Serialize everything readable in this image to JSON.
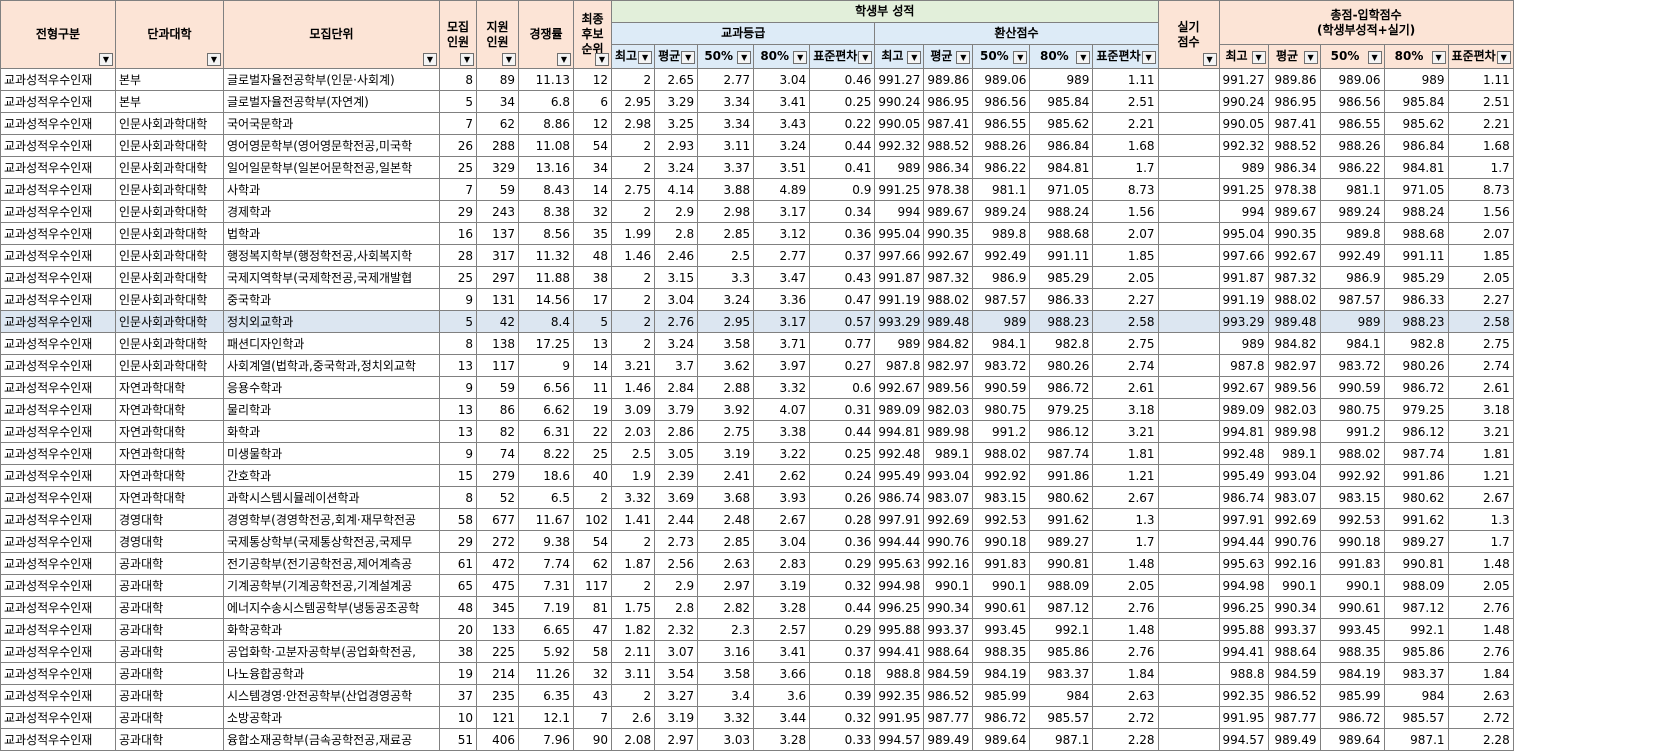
{
  "headers": {
    "type": "전형구분",
    "college": "단과대학",
    "unit": "모집단위",
    "quota": "모집\n인원",
    "applicants": "지원\n인원",
    "ratio": "경쟁률",
    "waitlist": "최종\n후보\n순위",
    "record_group": "학생부 성적",
    "grade_group": "교과등급",
    "converted_group": "환산점수",
    "practical": "실기\n점수",
    "total_group": "총점-입학점수\n(학생부성적+실기)",
    "stats": [
      "최고",
      "평균",
      "50%",
      "80%",
      "표준편차"
    ]
  },
  "filter_icon": "dropdown-arrow-icon",
  "colors": {
    "header_pink": "#fce4d6",
    "header_green": "#e2efda",
    "header_blue": "#ddebf7",
    "highlight_row": "#dce6f1"
  },
  "rows": [
    [
      "교과성적우수인재",
      "본부",
      "글로벌자율전공학부(인문·사회계)",
      "8",
      "89",
      "11.13",
      "12",
      "2",
      "2.65",
      "2.77",
      "3.04",
      "0.46",
      "991.27",
      "989.86",
      "989.06",
      "989",
      "1.11",
      "",
      "991.27",
      "989.86",
      "989.06",
      "989",
      "1.11"
    ],
    [
      "교과성적우수인재",
      "본부",
      "글로벌자율전공학부(자연계)",
      "5",
      "34",
      "6.8",
      "6",
      "2.95",
      "3.29",
      "3.34",
      "3.41",
      "0.25",
      "990.24",
      "986.95",
      "986.56",
      "985.84",
      "2.51",
      "",
      "990.24",
      "986.95",
      "986.56",
      "985.84",
      "2.51"
    ],
    [
      "교과성적우수인재",
      "인문사회과학대학",
      "국어국문학과",
      "7",
      "62",
      "8.86",
      "12",
      "2.98",
      "3.25",
      "3.34",
      "3.43",
      "0.22",
      "990.05",
      "987.41",
      "986.55",
      "985.62",
      "2.21",
      "",
      "990.05",
      "987.41",
      "986.55",
      "985.62",
      "2.21"
    ],
    [
      "교과성적우수인재",
      "인문사회과학대학",
      "영어영문학부(영어영문학전공,미국학",
      "26",
      "288",
      "11.08",
      "54",
      "2",
      "2.93",
      "3.11",
      "3.24",
      "0.44",
      "992.32",
      "988.52",
      "988.26",
      "986.84",
      "1.68",
      "",
      "992.32",
      "988.52",
      "988.26",
      "986.84",
      "1.68"
    ],
    [
      "교과성적우수인재",
      "인문사회과학대학",
      "일어일문학부(일본어문학전공,일본학",
      "25",
      "329",
      "13.16",
      "34",
      "2",
      "3.24",
      "3.37",
      "3.51",
      "0.41",
      "989",
      "986.34",
      "986.22",
      "984.81",
      "1.7",
      "",
      "989",
      "986.34",
      "986.22",
      "984.81",
      "1.7"
    ],
    [
      "교과성적우수인재",
      "인문사회과학대학",
      "사학과",
      "7",
      "59",
      "8.43",
      "14",
      "2.75",
      "4.14",
      "3.88",
      "4.89",
      "0.9",
      "991.25",
      "978.38",
      "981.1",
      "971.05",
      "8.73",
      "",
      "991.25",
      "978.38",
      "981.1",
      "971.05",
      "8.73"
    ],
    [
      "교과성적우수인재",
      "인문사회과학대학",
      "경제학과",
      "29",
      "243",
      "8.38",
      "32",
      "2",
      "2.9",
      "2.98",
      "3.17",
      "0.34",
      "994",
      "989.67",
      "989.24",
      "988.24",
      "1.56",
      "",
      "994",
      "989.67",
      "989.24",
      "988.24",
      "1.56"
    ],
    [
      "교과성적우수인재",
      "인문사회과학대학",
      "법학과",
      "16",
      "137",
      "8.56",
      "35",
      "1.99",
      "2.8",
      "2.85",
      "3.12",
      "0.36",
      "995.04",
      "990.35",
      "989.8",
      "988.68",
      "2.07",
      "",
      "995.04",
      "990.35",
      "989.8",
      "988.68",
      "2.07"
    ],
    [
      "교과성적우수인재",
      "인문사회과학대학",
      "행정복지학부(행정학전공,사회복지학",
      "28",
      "317",
      "11.32",
      "48",
      "1.46",
      "2.46",
      "2.5",
      "2.77",
      "0.37",
      "997.66",
      "992.67",
      "992.49",
      "991.11",
      "1.85",
      "",
      "997.66",
      "992.67",
      "992.49",
      "991.11",
      "1.85"
    ],
    [
      "교과성적우수인재",
      "인문사회과학대학",
      "국제지역학부(국제학전공,국제개발협",
      "25",
      "297",
      "11.88",
      "38",
      "2",
      "3.15",
      "3.3",
      "3.47",
      "0.43",
      "991.87",
      "987.32",
      "986.9",
      "985.29",
      "2.05",
      "",
      "991.87",
      "987.32",
      "986.9",
      "985.29",
      "2.05"
    ],
    [
      "교과성적우수인재",
      "인문사회과학대학",
      "중국학과",
      "9",
      "131",
      "14.56",
      "17",
      "2",
      "3.04",
      "3.24",
      "3.36",
      "0.47",
      "991.19",
      "988.02",
      "987.57",
      "986.33",
      "2.27",
      "",
      "991.19",
      "988.02",
      "987.57",
      "986.33",
      "2.27"
    ],
    [
      "교과성적우수인재",
      "인문사회과학대학",
      "정치외교학과",
      "5",
      "42",
      "8.4",
      "5",
      "2",
      "2.76",
      "2.95",
      "3.17",
      "0.57",
      "993.29",
      "989.48",
      "989",
      "988.23",
      "2.58",
      "",
      "993.29",
      "989.48",
      "989",
      "988.23",
      "2.58"
    ],
    [
      "교과성적우수인재",
      "인문사회과학대학",
      "패션디자인학과",
      "8",
      "138",
      "17.25",
      "13",
      "2",
      "3.24",
      "3.58",
      "3.71",
      "0.77",
      "989",
      "984.82",
      "984.1",
      "982.8",
      "2.75",
      "",
      "989",
      "984.82",
      "984.1",
      "982.8",
      "2.75"
    ],
    [
      "교과성적우수인재",
      "인문사회과학대학",
      "사회계열(법학과,중국학과,정치외교학",
      "13",
      "117",
      "9",
      "14",
      "3.21",
      "3.7",
      "3.62",
      "3.97",
      "0.27",
      "987.8",
      "982.97",
      "983.72",
      "980.26",
      "2.74",
      "",
      "987.8",
      "982.97",
      "983.72",
      "980.26",
      "2.74"
    ],
    [
      "교과성적우수인재",
      "자연과학대학",
      "응용수학과",
      "9",
      "59",
      "6.56",
      "11",
      "1.46",
      "2.84",
      "2.88",
      "3.32",
      "0.6",
      "992.67",
      "989.56",
      "990.59",
      "986.72",
      "2.61",
      "",
      "992.67",
      "989.56",
      "990.59",
      "986.72",
      "2.61"
    ],
    [
      "교과성적우수인재",
      "자연과학대학",
      "물리학과",
      "13",
      "86",
      "6.62",
      "19",
      "3.09",
      "3.79",
      "3.92",
      "4.07",
      "0.31",
      "989.09",
      "982.03",
      "980.75",
      "979.25",
      "3.18",
      "",
      "989.09",
      "982.03",
      "980.75",
      "979.25",
      "3.18"
    ],
    [
      "교과성적우수인재",
      "자연과학대학",
      "화학과",
      "13",
      "82",
      "6.31",
      "22",
      "2.03",
      "2.86",
      "2.75",
      "3.38",
      "0.44",
      "994.81",
      "989.98",
      "991.2",
      "986.12",
      "3.21",
      "",
      "994.81",
      "989.98",
      "991.2",
      "986.12",
      "3.21"
    ],
    [
      "교과성적우수인재",
      "자연과학대학",
      "미생물학과",
      "9",
      "74",
      "8.22",
      "25",
      "2.5",
      "3.05",
      "3.19",
      "3.22",
      "0.25",
      "992.48",
      "989.1",
      "988.02",
      "987.74",
      "1.81",
      "",
      "992.48",
      "989.1",
      "988.02",
      "987.74",
      "1.81"
    ],
    [
      "교과성적우수인재",
      "자연과학대학",
      "간호학과",
      "15",
      "279",
      "18.6",
      "40",
      "1.9",
      "2.39",
      "2.41",
      "2.62",
      "0.24",
      "995.49",
      "993.04",
      "992.92",
      "991.86",
      "1.21",
      "",
      "995.49",
      "993.04",
      "992.92",
      "991.86",
      "1.21"
    ],
    [
      "교과성적우수인재",
      "자연과학대학",
      "과학시스템시뮬레이션학과",
      "8",
      "52",
      "6.5",
      "2",
      "3.32",
      "3.69",
      "3.68",
      "3.93",
      "0.26",
      "986.74",
      "983.07",
      "983.15",
      "980.62",
      "2.67",
      "",
      "986.74",
      "983.07",
      "983.15",
      "980.62",
      "2.67"
    ],
    [
      "교과성적우수인재",
      "경영대학",
      "경영학부(경영학전공,회계·재무학전공",
      "58",
      "677",
      "11.67",
      "102",
      "1.41",
      "2.44",
      "2.48",
      "2.67",
      "0.28",
      "997.91",
      "992.69",
      "992.53",
      "991.62",
      "1.3",
      "",
      "997.91",
      "992.69",
      "992.53",
      "991.62",
      "1.3"
    ],
    [
      "교과성적우수인재",
      "경영대학",
      "국제통상학부(국제통상학전공,국제무",
      "29",
      "272",
      "9.38",
      "54",
      "2",
      "2.73",
      "2.85",
      "3.04",
      "0.36",
      "994.44",
      "990.76",
      "990.18",
      "989.27",
      "1.7",
      "",
      "994.44",
      "990.76",
      "990.18",
      "989.27",
      "1.7"
    ],
    [
      "교과성적우수인재",
      "공과대학",
      "전기공학부(전기공학전공,제어계측공",
      "61",
      "472",
      "7.74",
      "62",
      "1.87",
      "2.56",
      "2.63",
      "2.83",
      "0.29",
      "995.63",
      "992.16",
      "991.83",
      "990.81",
      "1.48",
      "",
      "995.63",
      "992.16",
      "991.83",
      "990.81",
      "1.48"
    ],
    [
      "교과성적우수인재",
      "공과대학",
      "기계공학부(기계공학전공,기계설계공",
      "65",
      "475",
      "7.31",
      "117",
      "2",
      "2.9",
      "2.97",
      "3.19",
      "0.32",
      "994.98",
      "990.1",
      "990.1",
      "988.09",
      "2.05",
      "",
      "994.98",
      "990.1",
      "990.1",
      "988.09",
      "2.05"
    ],
    [
      "교과성적우수인재",
      "공과대학",
      "에너지수송시스템공학부(냉동공조공학",
      "48",
      "345",
      "7.19",
      "81",
      "1.75",
      "2.8",
      "2.82",
      "3.28",
      "0.44",
      "996.25",
      "990.34",
      "990.61",
      "987.12",
      "2.76",
      "",
      "996.25",
      "990.34",
      "990.61",
      "987.12",
      "2.76"
    ],
    [
      "교과성적우수인재",
      "공과대학",
      "화학공학과",
      "20",
      "133",
      "6.65",
      "47",
      "1.82",
      "2.32",
      "2.3",
      "2.57",
      "0.29",
      "995.88",
      "993.37",
      "993.45",
      "992.1",
      "1.48",
      "",
      "995.88",
      "993.37",
      "993.45",
      "992.1",
      "1.48"
    ],
    [
      "교과성적우수인재",
      "공과대학",
      "공업화학·고분자공학부(공업화학전공,",
      "38",
      "225",
      "5.92",
      "58",
      "2.11",
      "3.07",
      "3.16",
      "3.41",
      "0.37",
      "994.41",
      "988.64",
      "988.35",
      "985.86",
      "2.76",
      "",
      "994.41",
      "988.64",
      "988.35",
      "985.86",
      "2.76"
    ],
    [
      "교과성적우수인재",
      "공과대학",
      "나노융합공학과",
      "19",
      "214",
      "11.26",
      "32",
      "3.11",
      "3.54",
      "3.58",
      "3.66",
      "0.18",
      "988.8",
      "984.59",
      "984.19",
      "983.37",
      "1.84",
      "",
      "988.8",
      "984.59",
      "984.19",
      "983.37",
      "1.84"
    ],
    [
      "교과성적우수인재",
      "공과대학",
      "시스템경영·안전공학부(산업경영공학",
      "37",
      "235",
      "6.35",
      "43",
      "2",
      "3.27",
      "3.4",
      "3.6",
      "0.39",
      "992.35",
      "986.52",
      "985.99",
      "984",
      "2.63",
      "",
      "992.35",
      "986.52",
      "985.99",
      "984",
      "2.63"
    ],
    [
      "교과성적우수인재",
      "공과대학",
      "소방공학과",
      "10",
      "121",
      "12.1",
      "7",
      "2.6",
      "3.19",
      "3.32",
      "3.44",
      "0.32",
      "991.95",
      "987.77",
      "986.72",
      "985.57",
      "2.72",
      "",
      "991.95",
      "987.77",
      "986.72",
      "985.57",
      "2.72"
    ],
    [
      "교과성적우수인재",
      "공과대학",
      "융합소재공학부(금속공학전공,재료공",
      "51",
      "406",
      "7.96",
      "90",
      "2.08",
      "2.97",
      "3.03",
      "3.28",
      "0.33",
      "994.57",
      "989.49",
      "989.64",
      "987.1",
      "2.28",
      "",
      "994.57",
      "989.49",
      "989.64",
      "987.1",
      "2.28"
    ]
  ],
  "highlighted_row_index": 11
}
